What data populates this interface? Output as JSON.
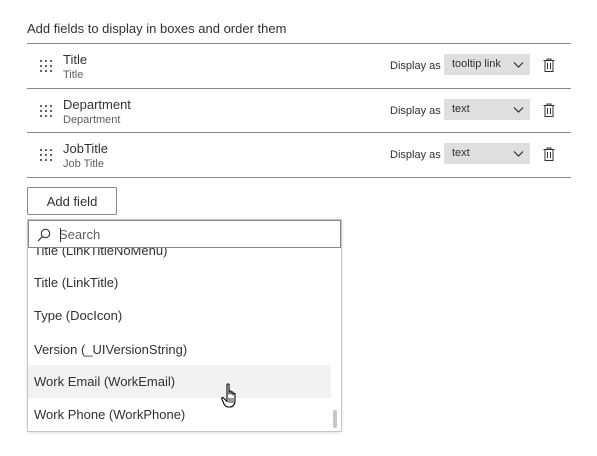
{
  "heading": "Add fields to display in boxes and order them",
  "fields": [
    {
      "name": "Title",
      "sub": "Title",
      "display_as_label": "Display as",
      "display_value": "tooltip link"
    },
    {
      "name": "Department",
      "sub": "Department",
      "display_as_label": "Display as",
      "display_value": "text"
    },
    {
      "name": "JobTitle",
      "sub": "Job Title",
      "display_as_label": "Display as",
      "display_value": "text"
    }
  ],
  "add_field_label": "Add field",
  "search": {
    "placeholder": "Search",
    "value": ""
  },
  "options": [
    "Title (LinkTitleNoMenu)",
    "Title (LinkTitle)",
    "Type (DocIcon)",
    "Version (_UIVersionString)",
    "Work Email (WorkEmail)",
    "Work Phone (WorkPhone)"
  ],
  "hovered_option": "Work Email (WorkEmail)",
  "icons": {
    "drag": "grip-dots-icon",
    "dropdown": "chevron-down-icon",
    "delete": "trash-icon",
    "search": "search-icon",
    "pointer": "hand-pointer-icon"
  },
  "colors": {
    "text": "#323130",
    "select_bg": "#e1dfdd",
    "hover_bg": "#f3f2f1",
    "border": "#8a8886"
  }
}
